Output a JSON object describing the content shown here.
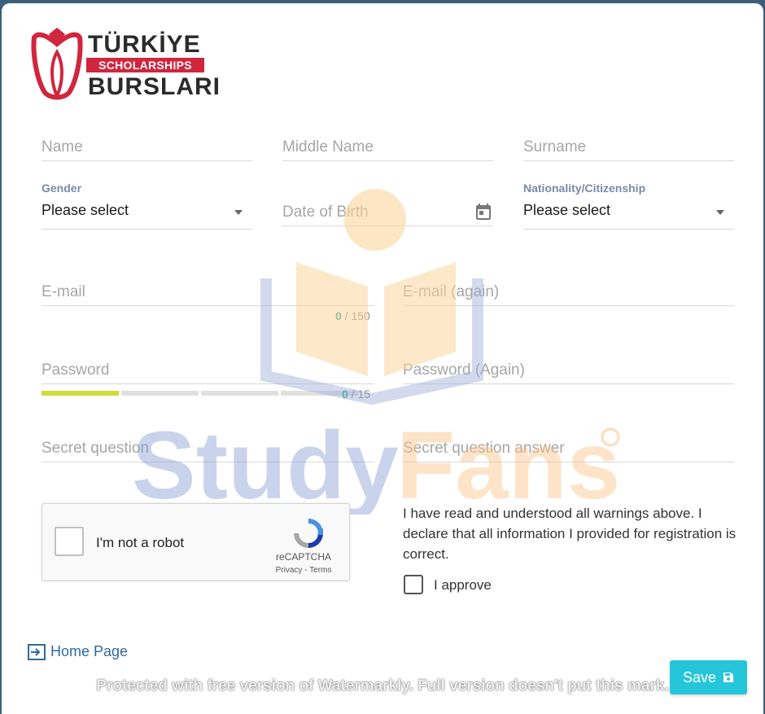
{
  "logo": {
    "line1": "TÜRKİYE",
    "band": "SCHOLARSHIPS",
    "line2": "BURSLARI",
    "brand_color": "#d0263e"
  },
  "form": {
    "name_placeholder": "Name",
    "middle_name_placeholder": "Middle Name",
    "surname_placeholder": "Surname",
    "gender_label": "Gender",
    "gender_value": "Please select",
    "dob_placeholder": "Date of Birth",
    "nationality_label": "Nationality/Citizenship",
    "nationality_value": "Please select",
    "email_placeholder": "E-mail",
    "email_counter_current": "0",
    "email_counter_max": " / 150",
    "email_again_placeholder": "E-mail (again)",
    "password_placeholder": "Password",
    "password_counter_current": "0",
    "password_counter_max": " / 15",
    "password_again_placeholder": "Password (Again)",
    "password_strength_level": 0.25,
    "secret_question_placeholder": "Secret question",
    "secret_answer_placeholder": "Secret question answer"
  },
  "captcha": {
    "label": "I'm not a robot",
    "brand": "reCAPTCHA",
    "terms": "Privacy - Terms"
  },
  "declaration": {
    "text": "I have read and understood all warnings above. I declare that all information I provided for registration is correct.",
    "approve_label": "I approve"
  },
  "footer": {
    "home_link": "Home Page",
    "save_label": "Save",
    "accent_color": "#26c6da"
  },
  "watermarks": {
    "logo_text": "StudyFans",
    "logo_part1": "Study",
    "logo_part2": "Fans",
    "notice": "Protected with free version of Watermarkly. Full version doesn't put this mark."
  }
}
